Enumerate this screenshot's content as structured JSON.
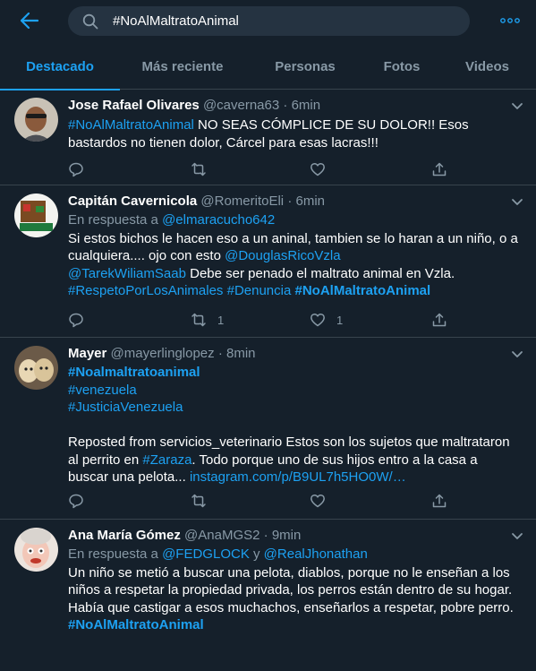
{
  "search": {
    "query": "#NoAlMaltratoAnimal"
  },
  "tabs": [
    {
      "label": "Destacado"
    },
    {
      "label": "Más reciente"
    },
    {
      "label": "Personas"
    },
    {
      "label": "Fotos"
    },
    {
      "label": "Videos"
    }
  ],
  "colors": {
    "background": "#15202b",
    "accent": "#1da1f2",
    "muted": "#8899a6",
    "divider": "#38444d"
  },
  "tweets": [
    {
      "name": "Jose Rafael Olivares",
      "handle": "@caverna63",
      "dot": "·",
      "time": "6min",
      "text": {
        "hashtag": "#NoAlMaltratoAnimal",
        "line1_rest": " NO SEAS CÓMPLICE DE SU DOLOR!! Esos",
        "line2": "bastardos no tienen dolor, Cárcel para esas lacras!!!"
      },
      "retweets": "",
      "likes": ""
    },
    {
      "name": "Capitán Cavernicola",
      "handle": "@RomeritoEli",
      "dot": "·",
      "time": "6min",
      "reply_to_prefix": "En respuesta a ",
      "reply_to": "@elmaracucho642",
      "text": {
        "line1": "Si estos bichos le hacen eso a un aninal, tambien se lo haran a un niño, o a",
        "line2_prefix": "cualquiera.... ojo con esto ",
        "mention1": "@DouglasRicoVzla",
        "mention2": "@TarekWiliamSaab",
        "line3_rest": " Debe ser penado el maltrato animal en Vzla.",
        "hashtag1": "#RespetoPorLosAnimales",
        "hashtag2": "#Denuncia",
        "hashtag3": "#NoAlMaltratoAnimal"
      },
      "retweets": "1",
      "likes": "1"
    },
    {
      "name": "Mayer",
      "handle": "@mayerlinglopez",
      "dot": "·",
      "time": "8min",
      "text": {
        "hashtag1": "#Noalmaltratoanimal",
        "hashtag2": "#venezuela",
        "hashtag3": "#JusticiaVenezuela",
        "para_line1": "Reposted from servicios_veterinario Estos son los sujetos que maltrataron",
        "para_line2_prefix": "al perrito en ",
        "hashtag4": "#Zaraza",
        "para_line2_rest": ". Todo porque uno de sus hijos entro a la casa a",
        "para_line3": "buscar una pelota... ",
        "url": "instagram.com/p/B9UL7h5HO0W/…"
      },
      "retweets": "",
      "likes": ""
    },
    {
      "name": "Ana María Gómez",
      "handle": "@AnaMGS2",
      "dot": "·",
      "time": "9min",
      "reply_to_prefix": "En respuesta a ",
      "reply_to": "@FEDGLOCK",
      "reply_and": " y ",
      "reply_to2": "@RealJhonathan",
      "text": {
        "line1": "Un niño se metió a buscar una pelota, diablos, porque no le enseñan a los",
        "line2": "niños a respetar la propiedad privada, los perros están dentro de su hogar.",
        "line3": "Había que castigar a esos muchachos, enseñarlos a respetar, pobre perro.",
        "hashtag": "#NoAlMaltratoAnimal"
      },
      "retweets": "",
      "likes": ""
    }
  ]
}
